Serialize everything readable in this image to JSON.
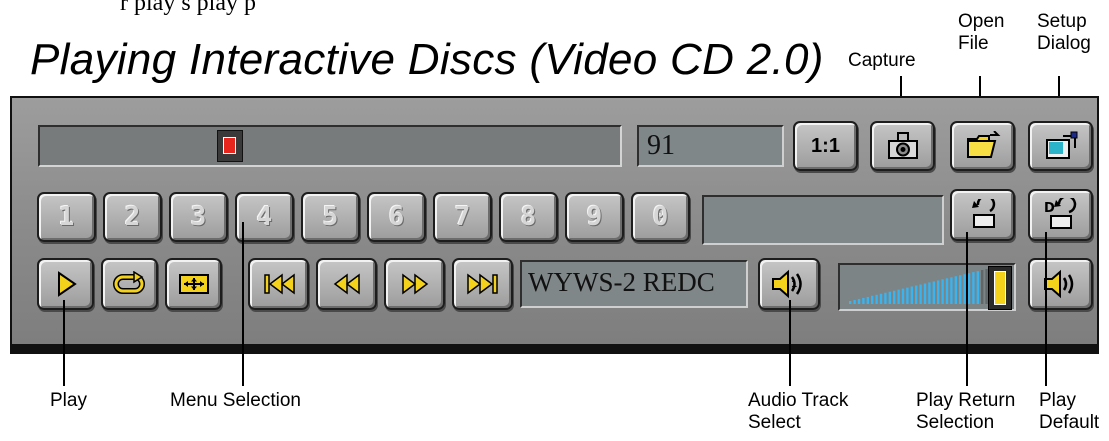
{
  "top_partial_text": "r  play  s  play  p",
  "title": "Playing Interactive Discs (Video CD 2.0)",
  "callouts": {
    "capture": "Capture",
    "open_file": [
      "Open",
      "File"
    ],
    "setup_dialog": [
      "Setup",
      "Dialog"
    ],
    "play": "Play",
    "menu_selection": "Menu Selection",
    "audio_track_select": [
      "Audio Track",
      "Select"
    ],
    "play_return_selection": [
      "Play Return",
      "Selection"
    ],
    "play_default": [
      "Play",
      "Default"
    ]
  },
  "player": {
    "seek_position": 0.32,
    "counter": "91",
    "ratio_label": "1:1",
    "number_keys": [
      "1",
      "2",
      "3",
      "4",
      "5",
      "6",
      "7",
      "8",
      "9",
      "0"
    ],
    "entry_field": "",
    "disc_label": "WYWS-2 REDC",
    "volume_level": 0.95,
    "colors": {
      "accent_yellow": "#f4d21c",
      "volume_blue": "#38b4f0",
      "seek_thumb_red": "#e8261d"
    }
  },
  "icons": [
    "play-icon",
    "repeat-icon",
    "fit-screen-icon",
    "previous-track-icon",
    "rewind-icon",
    "fast-forward-icon",
    "next-track-icon",
    "audio-track-icon",
    "camera-icon",
    "folder-open-icon",
    "setup-icon",
    "return-icon",
    "default-icon",
    "speaker-icon"
  ]
}
